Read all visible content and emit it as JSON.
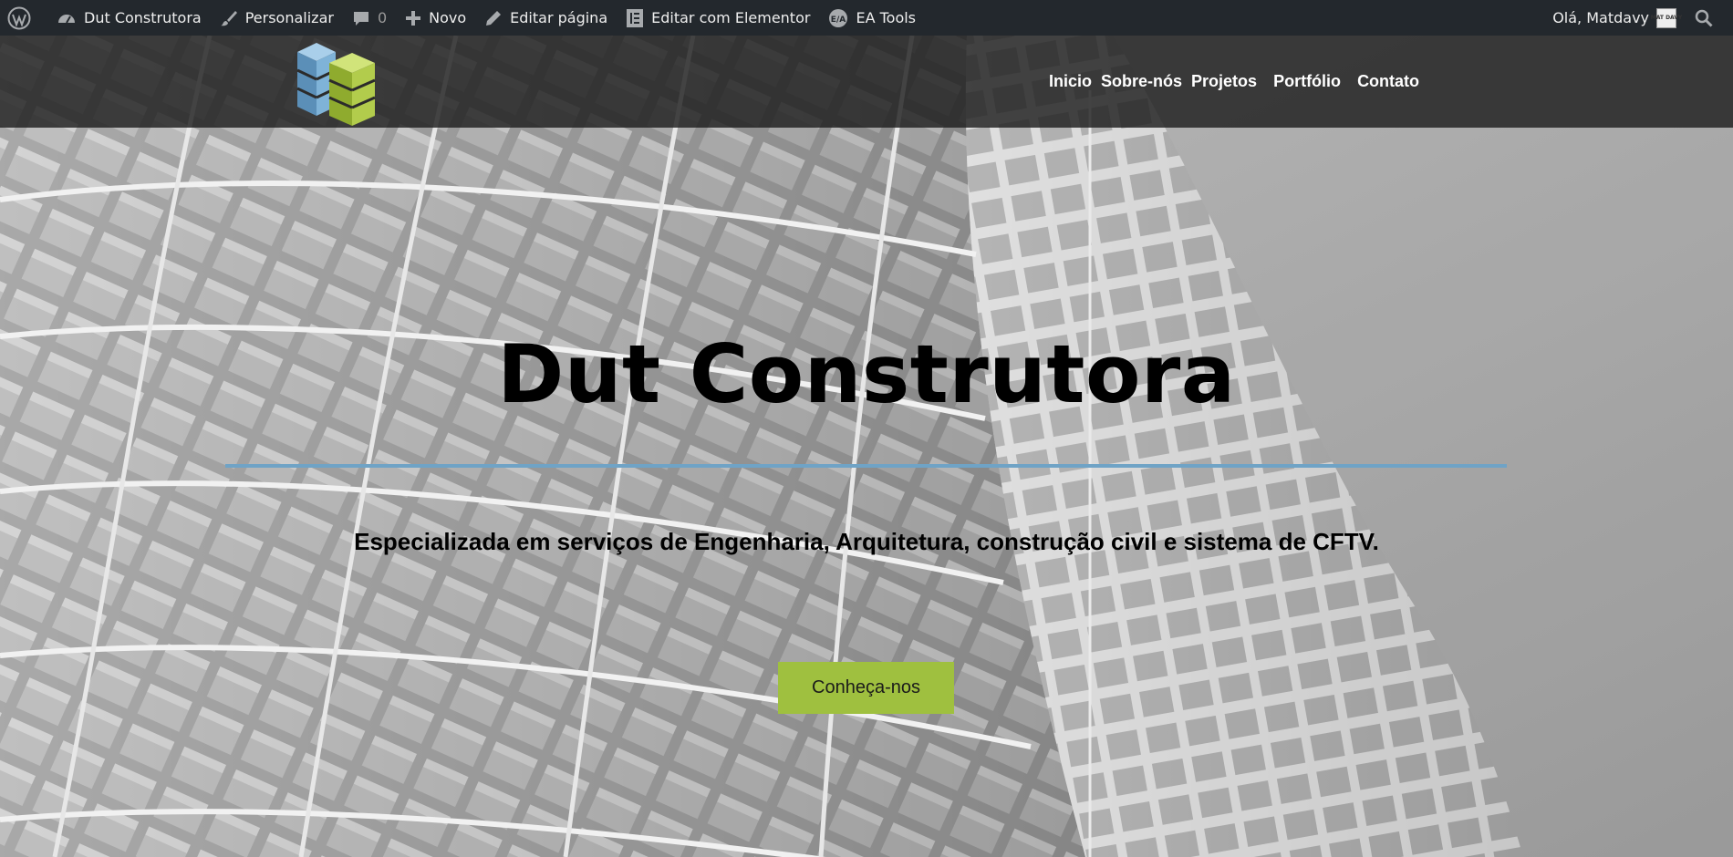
{
  "adminbar": {
    "site_name": "Dut Construtora",
    "customize": "Personalizar",
    "comments_count": "0",
    "new": "Novo",
    "edit_page": "Editar página",
    "edit_elementor": "Editar com Elementor",
    "ea_tools": "EA Tools",
    "greeting": "Olá, Matdavy",
    "avatar_text": "MAT DAVY"
  },
  "nav": {
    "items": [
      "Inicio",
      "Sobre-nós",
      "Projetos",
      "Portfólio",
      "Contato"
    ]
  },
  "hero": {
    "title": "Dut Construtora",
    "tagline": "Especializada em serviços de Engenharia, Arquitetura, construção civil e sistema de CFTV.",
    "cta_label": "Conheça-nos"
  },
  "colors": {
    "adminbar_bg": "#23282d",
    "accent_green": "#9fc03f",
    "divider_blue": "#6fa3c6",
    "logo_blue": "#7fb3d8",
    "logo_green": "#b2cc4c"
  },
  "icons": {
    "wordpress": "wordpress-logo-icon",
    "dashboard": "gauge-icon",
    "customize": "paintbrush-icon",
    "comments": "comment-bubble-icon",
    "new": "plus-icon",
    "edit": "pencil-icon",
    "elementor": "elementor-icon",
    "ea_tools": "ea-tools-icon",
    "search": "search-icon"
  }
}
